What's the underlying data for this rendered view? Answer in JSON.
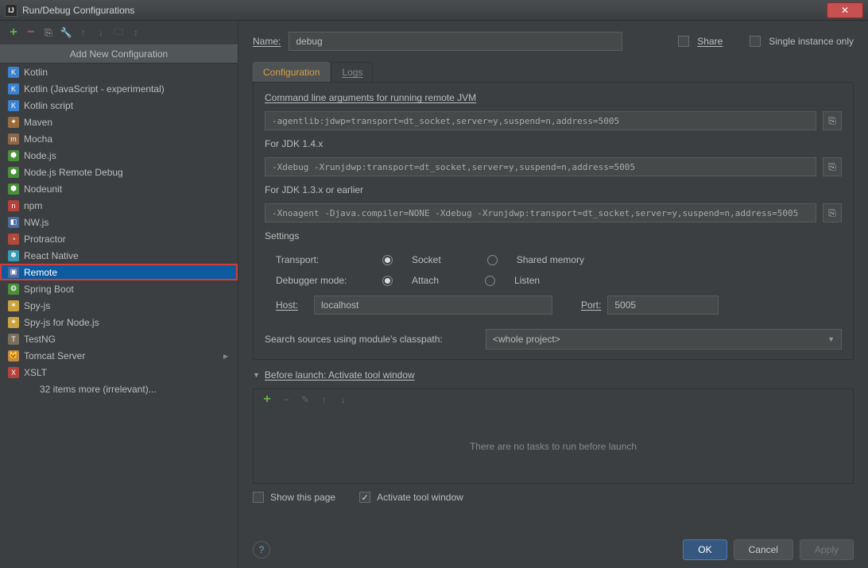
{
  "window": {
    "title": "Run/Debug Configurations"
  },
  "toolbar": {
    "dropdown_header": "Add New Configuration"
  },
  "configTypes": [
    {
      "label": "Kotlin",
      "color": "#3b82d0",
      "glyph": "K"
    },
    {
      "label": "Kotlin (JavaScript - experimental)",
      "color": "#3b82d0",
      "glyph": "K"
    },
    {
      "label": "Kotlin script",
      "color": "#3b82d0",
      "glyph": "K"
    },
    {
      "label": "Maven",
      "color": "#9a6b3a",
      "glyph": "✦"
    },
    {
      "label": "Mocha",
      "color": "#8d6748",
      "glyph": "m"
    },
    {
      "label": "Node.js",
      "color": "#4a8f3a",
      "glyph": "⬢"
    },
    {
      "label": "Node.js Remote Debug",
      "color": "#4a8f3a",
      "glyph": "⬢"
    },
    {
      "label": "Nodeunit",
      "color": "#4a8f3a",
      "glyph": "⬢"
    },
    {
      "label": "npm",
      "color": "#b5413b",
      "glyph": "n"
    },
    {
      "label": "NW.js",
      "color": "#4b6aa0",
      "glyph": "◧"
    },
    {
      "label": "Protractor",
      "color": "#b24a3b",
      "glyph": "◔"
    },
    {
      "label": "React Native",
      "color": "#3a9bb0",
      "glyph": "✽"
    },
    {
      "label": "Remote",
      "color": "#4b6aa0",
      "glyph": "▣",
      "selected": true
    },
    {
      "label": "Spring Boot",
      "color": "#4a8f3a",
      "glyph": "❂"
    },
    {
      "label": "Spy-js",
      "color": "#caa23f",
      "glyph": "✶"
    },
    {
      "label": "Spy-js for Node.js",
      "color": "#caa23f",
      "glyph": "✶"
    },
    {
      "label": "TestNG",
      "color": "#7a6f5a",
      "glyph": "T"
    },
    {
      "label": "Tomcat Server",
      "color": "#c78a3f",
      "glyph": "🐱",
      "expandable": true
    },
    {
      "label": "XSLT",
      "color": "#b5413b",
      "glyph": "X"
    },
    {
      "label": "32 items more (irrelevant)...",
      "color": "transparent",
      "glyph": "",
      "more": true
    }
  ],
  "form": {
    "name_label": "Name:",
    "name_value": "debug",
    "share_label": "Share",
    "single_label": "Single instance only",
    "tab_config": "Configuration",
    "tab_logs": "Logs",
    "cmd_label": "Command line arguments for running remote JVM",
    "cmd_value": "-agentlib:jdwp=transport=dt_socket,server=y,suspend=n,address=5005",
    "jdk14_label": "For JDK 1.4.x",
    "jdk14_value": "-Xdebug -Xrunjdwp:transport=dt_socket,server=y,suspend=n,address=5005",
    "jdk13_label": "For JDK 1.3.x or earlier",
    "jdk13_value": "-Xnoagent -Djava.compiler=NONE -Xdebug -Xrunjdwp:transport=dt_socket,server=y,suspend=n,address=5005",
    "settings_title": "Settings",
    "transport_label": "Transport:",
    "transport_socket": "Socket",
    "transport_shared": "Shared memory",
    "debugger_label": "Debugger mode:",
    "debugger_attach": "Attach",
    "debugger_listen": "Listen",
    "host_label": "Host:",
    "host_value": "localhost",
    "port_label": "Port:",
    "port_value": "5005",
    "classpath_label": "Search sources using module's classpath:",
    "classpath_value": "<whole project>",
    "before_section": "Before launch: Activate tool window",
    "before_empty": "There are no tasks to run before launch",
    "show_page": "Show this page",
    "activate_tw": "Activate tool window",
    "ok": "OK",
    "cancel": "Cancel",
    "apply": "Apply"
  }
}
